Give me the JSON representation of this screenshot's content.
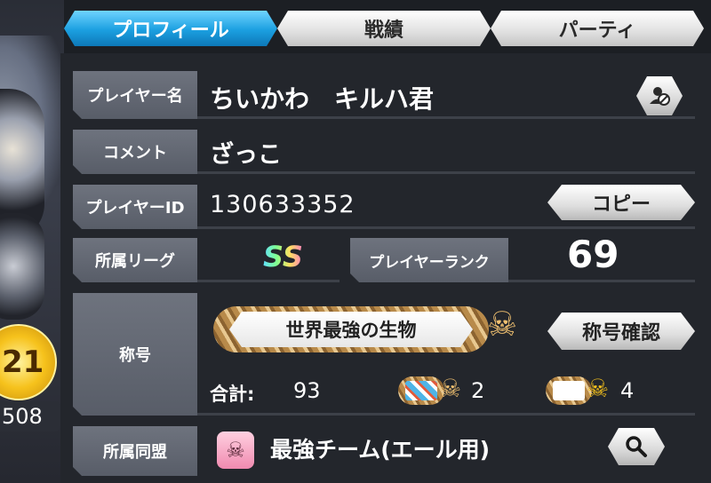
{
  "left_art": {
    "medal_number": "21",
    "level_number": "508"
  },
  "tabs": {
    "profile": "プロフィール",
    "record": "戦績",
    "party": "パーティ"
  },
  "profile": {
    "player_name_label": "プレイヤー名",
    "player_name": "ちいかわ　キルハ君",
    "comment_label": "コメント",
    "comment": "ざっこ",
    "player_id_label": "プレイヤーID",
    "player_id": "130633352",
    "copy_button": "コピー",
    "league_label": "所属リーグ",
    "league_badge": "SS",
    "rank_label": "プレイヤーランク",
    "rank": "69",
    "title_label": "称号",
    "title_name": "世界最強の生物",
    "title_confirm_button": "称号確認",
    "total_label": "合計:",
    "total_count": "93",
    "special_title_count": "2",
    "skull_title_count": "4",
    "alliance_label": "所属同盟",
    "alliance_name": "最強チーム(エール用)"
  },
  "icons": {
    "block_user": "block-user-icon",
    "search": "search-icon",
    "skull": "skull-crossbones-icon",
    "alliance_flag": "alliance-flag-icon"
  },
  "colors": {
    "tab_active": "#1b9fe0",
    "panel_bg": "#23262c",
    "label_bg": "#5f6470"
  }
}
